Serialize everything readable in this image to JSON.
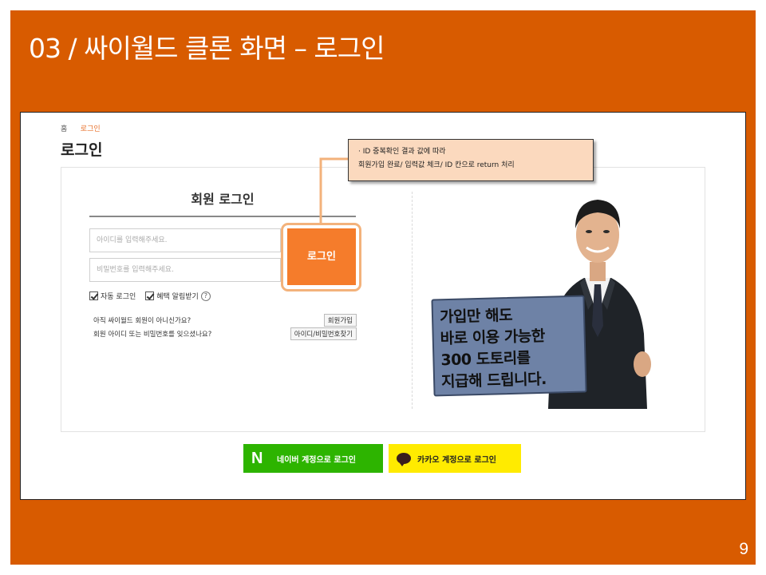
{
  "slide": {
    "title": "03 / 싸이월드 클론 화면 – 로그인",
    "page_number": "9"
  },
  "breadcrumb": {
    "home": "홈",
    "current": "로그인"
  },
  "page_heading": "로그인",
  "login_form": {
    "title": "회원 로그인",
    "id_placeholder": "아이디를 입력해주세요.",
    "pw_placeholder": "비밀번호를 입력해주세요.",
    "login_button": "로그인",
    "auto_login": "자동 로그인",
    "benefit_alert": "혜택 알림받기",
    "help_icon": "?",
    "not_member_text": "아직 싸이월드 회원이 아니신가요?",
    "signup_button": "회원가입",
    "forgot_text": "회원 아이디 또는 비밀번호를 잊으셨나요?",
    "find_button": "아이디/비밀번호찾기"
  },
  "annotation": {
    "line1": "· ID 중복확인 결과 값에 따라",
    "line2": "회원가입 완료/ 입력값 체크/ ID 칸으로 return 처리"
  },
  "ad": {
    "line1": "가입만 해도",
    "line2": "바로 이용 가능한",
    "line3": "300 도토리를",
    "line4": "지급해 드립니다."
  },
  "social": {
    "naver_label": "네이버 계정으로 로그인",
    "naver_logo": "N",
    "kakao_label": "카카오 계정으로 로그인"
  },
  "colors": {
    "slide_background": "#D85B00",
    "login_button": "#F57C2B",
    "naver": "#2DB400",
    "kakao": "#FFEB00",
    "annotation_bg": "#FBD9BE"
  }
}
